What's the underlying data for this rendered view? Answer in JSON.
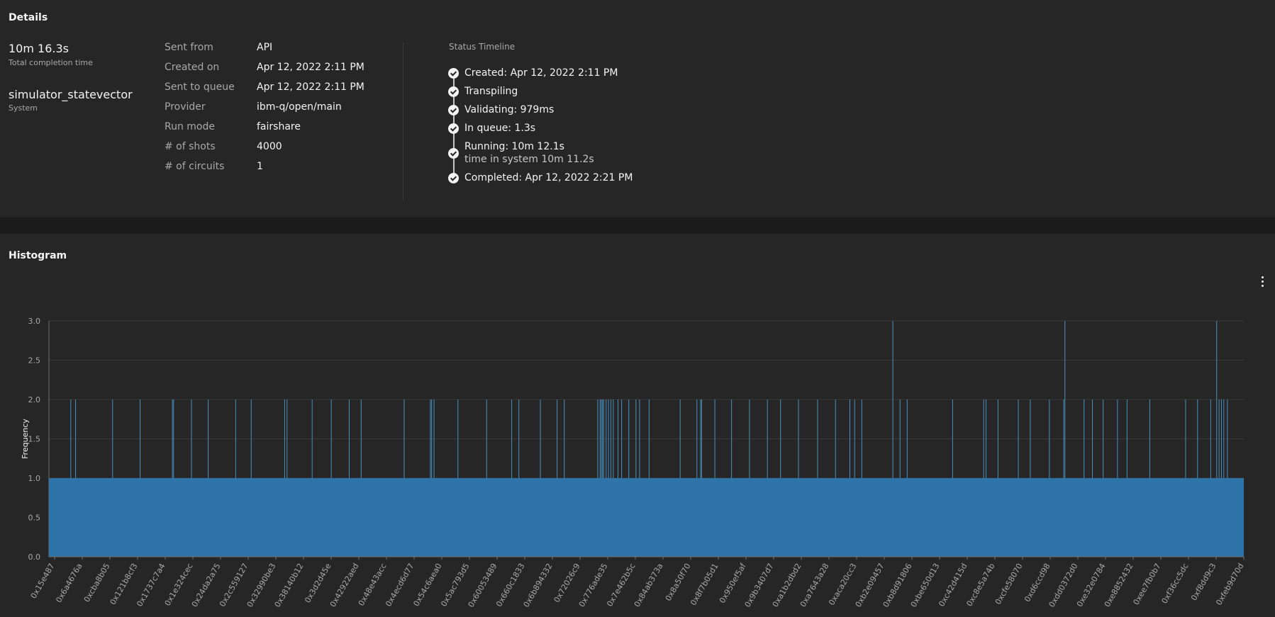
{
  "details": {
    "title": "Details",
    "completion_time": "10m 16.3s",
    "completion_caption": "Total completion time",
    "system": "simulator_statevector",
    "system_caption": "System",
    "fields": [
      {
        "label": "Sent from",
        "value": "API"
      },
      {
        "label": "Created on",
        "value": "Apr 12, 2022 2:11 PM"
      },
      {
        "label": "Sent to queue",
        "value": "Apr 12, 2022 2:11 PM"
      },
      {
        "label": "Provider",
        "value": "ibm-q/open/main"
      },
      {
        "label": "Run mode",
        "value": "fairshare"
      },
      {
        "label": "# of shots",
        "value": "4000"
      },
      {
        "label": "# of circuits",
        "value": "1"
      }
    ]
  },
  "timeline": {
    "title": "Status Timeline",
    "items": [
      {
        "text": "Created: Apr 12, 2022 2:11 PM",
        "sub": ""
      },
      {
        "text": "Transpiling",
        "sub": ""
      },
      {
        "text": "Validating: 979ms",
        "sub": ""
      },
      {
        "text": "In queue: 1.3s",
        "sub": ""
      },
      {
        "text": "Running: 10m 12.1s",
        "sub": "time in system 10m 11.2s"
      },
      {
        "text": "Completed: Apr 12, 2022 2:21 PM",
        "sub": ""
      }
    ]
  },
  "histogram": {
    "title": "Histogram",
    "overflow_icon": "overflow-menu-vertical-icon"
  },
  "colors": {
    "bar": "#2e74a8",
    "bar_edge": "#4a8fbd",
    "panel": "#262626",
    "background": "#1b1b1b"
  },
  "chart_data": {
    "type": "bar",
    "ylabel": "Frequency",
    "xlabel": "",
    "ylim": [
      0,
      3
    ],
    "yticks": [
      0.0,
      0.5,
      1.0,
      1.5,
      2.0,
      2.5,
      3.0
    ],
    "grid": true,
    "baseline_value": 1,
    "bar_count_approx": 3913,
    "x_tick_labels": [
      "0x15e487",
      "0x6a4676a",
      "0xcba8b05",
      "0x121b8cf3",
      "0x1737c7a4",
      "0x1e324cec",
      "0x24da2a75",
      "0x2c559127",
      "0x32990be3",
      "0x38140b12",
      "0x3d2d45e",
      "0x42922aed",
      "0x48e43acc",
      "0x4ecd6d77",
      "0x54c6aea0",
      "0x5ac793d5",
      "0x60053489",
      "0x660c1833",
      "0x6b894332",
      "0x72026c9",
      "0x776ade35",
      "0x7e462b5c",
      "0x84ab373a",
      "0x8a50f70",
      "0x8f7b05d1",
      "0x950ef5af",
      "0x9b3407d7",
      "0xa1b2dbd2",
      "0xa7643a28",
      "0xaca20cc3",
      "0xb2e09457",
      "0xb8d91806",
      "0xbe650d13",
      "0xc42d415d",
      "0xc8e5a74b",
      "0xcfe58070",
      "0xd6ccd98",
      "0xdd0372d0",
      "0xe32e0784",
      "0xe8852432",
      "0xee7fb0b7",
      "0xf36cc5dc",
      "0xf8dd9c3",
      "0xfeb9d70d"
    ],
    "freq2_positions": [
      0.018,
      0.022,
      0.053,
      0.076,
      0.103,
      0.104,
      0.119,
      0.133,
      0.156,
      0.169,
      0.197,
      0.199,
      0.22,
      0.236,
      0.251,
      0.261,
      0.297,
      0.319,
      0.32,
      0.322,
      0.342,
      0.366,
      0.387,
      0.393,
      0.411,
      0.425,
      0.431,
      0.459,
      0.461,
      0.462,
      0.463,
      0.464,
      0.466,
      0.468,
      0.47,
      0.472,
      0.476,
      0.479,
      0.485,
      0.491,
      0.494,
      0.502,
      0.528,
      0.542,
      0.545,
      0.546,
      0.557,
      0.571,
      0.586,
      0.601,
      0.612,
      0.627,
      0.643,
      0.658,
      0.67,
      0.674,
      0.68,
      0.712,
      0.718,
      0.756,
      0.782,
      0.784,
      0.794,
      0.811,
      0.821,
      0.837,
      0.849,
      0.866,
      0.873,
      0.882,
      0.894,
      0.902,
      0.921,
      0.951,
      0.961,
      0.972,
      0.979,
      0.981,
      0.983,
      0.986
    ],
    "freq3_positions": [
      0.706,
      0.85,
      0.977
    ]
  }
}
